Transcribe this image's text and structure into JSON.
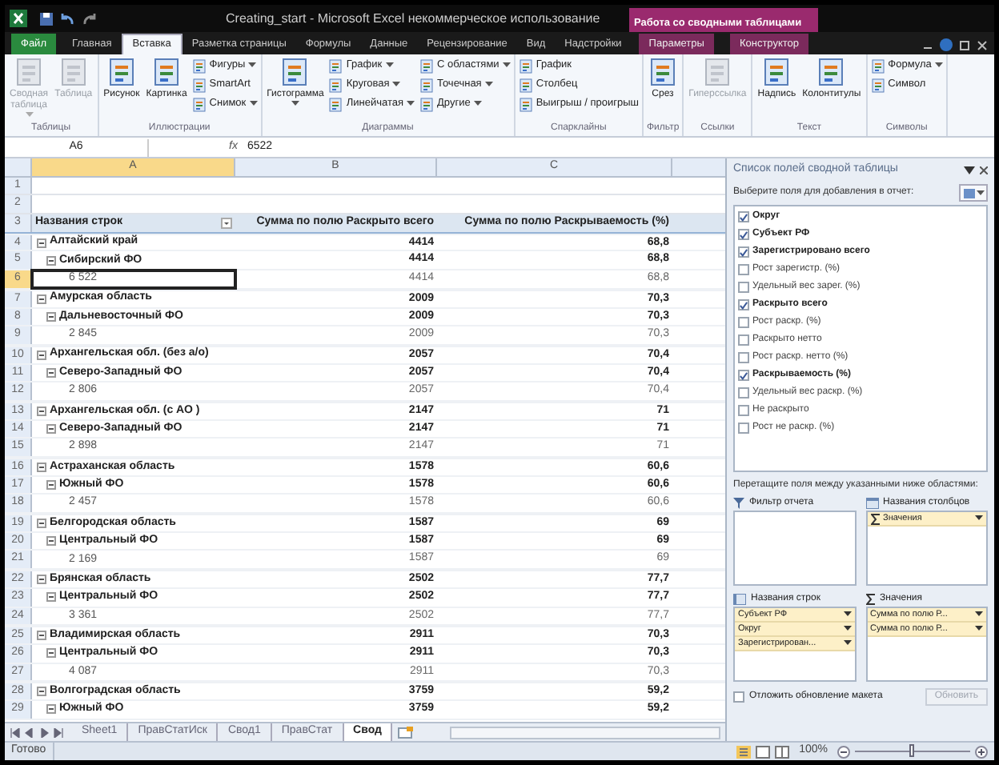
{
  "window": {
    "title": "Creating_start - Microsoft Excel некоммерческое использование",
    "contextual_group": "Работа со сводными таблицами"
  },
  "tabs": [
    {
      "label": "Файл",
      "kind": "file",
      "selected": false
    },
    {
      "label": "Главная",
      "kind": "normal",
      "selected": false
    },
    {
      "label": "Вставка",
      "kind": "normal",
      "selected": true
    },
    {
      "label": "Разметка страницы",
      "kind": "normal",
      "selected": false
    },
    {
      "label": "Формулы",
      "kind": "normal",
      "selected": false
    },
    {
      "label": "Данные",
      "kind": "normal",
      "selected": false
    },
    {
      "label": "Рецензирование",
      "kind": "normal",
      "selected": false
    },
    {
      "label": "Вид",
      "kind": "normal",
      "selected": false
    },
    {
      "label": "Надстройки",
      "kind": "normal",
      "selected": false
    },
    {
      "label": "Параметры",
      "kind": "contextual",
      "selected": false
    },
    {
      "label": "Конструктор",
      "kind": "contextual",
      "selected": false
    }
  ],
  "ribbon": [
    {
      "label": "Таблицы",
      "large": [
        {
          "label": "Сводная таблица",
          "disabled": true,
          "menu": true
        },
        {
          "label": "Таблица",
          "disabled": true,
          "menu": false
        }
      ]
    },
    {
      "label": "Иллюстрации",
      "large": [
        {
          "label": "Рисунок",
          "disabled": false,
          "menu": false
        },
        {
          "label": "Картинка",
          "disabled": false,
          "menu": false
        }
      ],
      "small": [
        {
          "label": "Фигуры",
          "menu": true
        },
        {
          "label": "SmartArt",
          "menu": false
        },
        {
          "label": "Снимок",
          "menu": true
        }
      ]
    },
    {
      "label": "Диаграммы",
      "large": [
        {
          "label": "Гистограмма",
          "disabled": false,
          "menu": true
        }
      ],
      "small": [
        {
          "label": "График",
          "menu": true
        },
        {
          "label": "Круговая",
          "menu": true
        },
        {
          "label": "Линейчатая",
          "menu": true
        },
        {
          "label": "С областями",
          "menu": true
        },
        {
          "label": "Точечная",
          "menu": true
        },
        {
          "label": "Другие",
          "menu": true
        }
      ]
    },
    {
      "label": "Спарклайны",
      "small": [
        {
          "label": "График",
          "menu": false
        },
        {
          "label": "Столбец",
          "menu": false
        },
        {
          "label": "Выигрыш / проигрыш",
          "menu": false
        }
      ]
    },
    {
      "label": "Фильтр",
      "large": [
        {
          "label": "Срез",
          "disabled": false,
          "menu": false
        }
      ]
    },
    {
      "label": "Ссылки",
      "large": [
        {
          "label": "Гиперссылка",
          "disabled": true,
          "menu": false
        }
      ]
    },
    {
      "label": "Текст",
      "large": [
        {
          "label": "Надпись",
          "disabled": false,
          "menu": false
        },
        {
          "label": "Колонтитулы",
          "disabled": false,
          "menu": false
        }
      ]
    },
    {
      "label": "Символы",
      "small": [
        {
          "label": "Формула",
          "menu": true
        },
        {
          "label": "Символ",
          "menu": false
        }
      ]
    }
  ],
  "formula_bar": {
    "name_box": "A6",
    "fx": "fx",
    "value": "6522"
  },
  "columns": [
    "A",
    "B",
    "C"
  ],
  "blank_rows": [
    "1",
    "2"
  ],
  "pivot_header": {
    "row": "3",
    "row_labels": "Названия строк",
    "col_b": "Сумма по полю Раскрыто всего",
    "col_c": "Сумма по полю Раскрываемость (%)"
  },
  "pivot_rows": [
    {
      "row": "4",
      "label": "Алтайский край",
      "b": "4414",
      "c": "68,8",
      "expanded": true,
      "selected": false,
      "children": [
        {
          "row": "5",
          "label": "Сибирский ФО",
          "b": "4414",
          "c": "68,8",
          "expanded": true,
          "selected": false,
          "children": [
            {
              "row": "6",
              "label": "6 522",
              "b": "4414",
              "c": "68,8",
              "selected": true
            }
          ]
        }
      ]
    },
    {
      "row": "7",
      "label": "Амурская область",
      "b": "2009",
      "c": "70,3",
      "expanded": true,
      "selected": false,
      "children": [
        {
          "row": "8",
          "label": "Дальневосточный ФО",
          "b": "2009",
          "c": "70,3",
          "expanded": true,
          "selected": false,
          "children": [
            {
              "row": "9",
              "label": "2 845",
              "b": "2009",
              "c": "70,3",
              "selected": false
            }
          ]
        }
      ]
    },
    {
      "row": "10",
      "label": "Архангельская обл. (без а/о)",
      "b": "2057",
      "c": "70,4",
      "expanded": true,
      "selected": false,
      "children": [
        {
          "row": "11",
          "label": "Северо-Западный ФО",
          "b": "2057",
          "c": "70,4",
          "expanded": true,
          "selected": false,
          "children": [
            {
              "row": "12",
              "label": "2 806",
              "b": "2057",
              "c": "70,4",
              "selected": false
            }
          ]
        }
      ]
    },
    {
      "row": "13",
      "label": "Архангельская обл. (с АО )",
      "b": "2147",
      "c": "71",
      "expanded": true,
      "selected": false,
      "children": [
        {
          "row": "14",
          "label": "Северо-Западный ФО",
          "b": "2147",
          "c": "71",
          "expanded": true,
          "selected": false,
          "children": [
            {
              "row": "15",
              "label": "2 898",
              "b": "2147",
              "c": "71",
              "selected": false
            }
          ]
        }
      ]
    },
    {
      "row": "16",
      "label": "Астраханская область",
      "b": "1578",
      "c": "60,6",
      "expanded": true,
      "selected": false,
      "children": [
        {
          "row": "17",
          "label": "Южный ФО",
          "b": "1578",
          "c": "60,6",
          "expanded": true,
          "selected": false,
          "children": [
            {
              "row": "18",
              "label": "2 457",
              "b": "1578",
              "c": "60,6",
              "selected": false
            }
          ]
        }
      ]
    },
    {
      "row": "19",
      "label": "Белгородская область",
      "b": "1587",
      "c": "69",
      "expanded": true,
      "selected": false,
      "children": [
        {
          "row": "20",
          "label": "Центральный ФО",
          "b": "1587",
          "c": "69",
          "expanded": true,
          "selected": false,
          "children": [
            {
              "row": "21",
              "label": "2 169",
              "b": "1587",
              "c": "69",
              "selected": false
            }
          ]
        }
      ]
    },
    {
      "row": "22",
      "label": "Брянская область",
      "b": "2502",
      "c": "77,7",
      "expanded": true,
      "selected": false,
      "children": [
        {
          "row": "23",
          "label": "Центральный ФО",
          "b": "2502",
          "c": "77,7",
          "expanded": true,
          "selected": false,
          "children": [
            {
              "row": "24",
              "label": "3 361",
              "b": "2502",
              "c": "77,7",
              "selected": false
            }
          ]
        }
      ]
    },
    {
      "row": "25",
      "label": "Владимирская область",
      "b": "2911",
      "c": "70,3",
      "expanded": true,
      "selected": false,
      "children": [
        {
          "row": "26",
          "label": "Центральный ФО",
          "b": "2911",
          "c": "70,3",
          "expanded": true,
          "selected": false,
          "children": [
            {
              "row": "27",
              "label": "4 087",
              "b": "2911",
              "c": "70,3",
              "selected": false
            }
          ]
        }
      ]
    },
    {
      "row": "28",
      "label": "Волгоградская область",
      "b": "3759",
      "c": "59,2",
      "expanded": true,
      "selected": false,
      "children": [
        {
          "row": "29",
          "label": "Южный ФО",
          "b": "3759",
          "c": "59,2",
          "expanded": true,
          "selected": false
        }
      ]
    }
  ],
  "sheet_tabs": [
    {
      "label": "Sheet1",
      "selected": false
    },
    {
      "label": "ПравСтатИск",
      "selected": false
    },
    {
      "label": "Свод1",
      "selected": false
    },
    {
      "label": "ПравСтат",
      "selected": false
    },
    {
      "label": "Свод",
      "selected": true
    }
  ],
  "field_list": {
    "title": "Список полей сводной таблицы",
    "prompt": "Выберите поля для добавления в отчет:",
    "fields": [
      {
        "label": "Округ",
        "checked": true
      },
      {
        "label": "Субъект РФ",
        "checked": true
      },
      {
        "label": "Зарегистрировано всего",
        "checked": true
      },
      {
        "label": "Рост зарегистр. (%)",
        "checked": false
      },
      {
        "label": "Удельный вес зарег. (%)",
        "checked": false
      },
      {
        "label": "Раскрыто всего",
        "checked": true
      },
      {
        "label": "Рост раскр. (%)",
        "checked": false
      },
      {
        "label": "Раскрыто нетто",
        "checked": false
      },
      {
        "label": "Рост раскр. нетто (%)",
        "checked": false
      },
      {
        "label": "Раскрываемость (%)",
        "checked": true
      },
      {
        "label": "Удельный вес раскр. (%)",
        "checked": false
      },
      {
        "label": "Не раскрыто",
        "checked": false
      },
      {
        "label": "Рост не раскр. (%)",
        "checked": false
      }
    ],
    "drag_prompt": "Перетащите поля между указанными ниже областями:",
    "areas": [
      {
        "kind": "filter",
        "label": "Фильтр отчета"
      },
      {
        "kind": "columns",
        "label": "Названия столбцов",
        "items": [
          "Значения"
        ]
      },
      {
        "kind": "rows",
        "label": "Названия строк",
        "items": [
          "Субъект РФ",
          "Округ",
          "Зарегистрирован..."
        ]
      },
      {
        "kind": "values",
        "label": "Значения",
        "items": [
          "Сумма по полю Р...",
          "Сумма по полю Р..."
        ]
      }
    ],
    "defer": {
      "label": "Отложить обновление макета",
      "checked": false
    },
    "update_button": {
      "label": "Обновить",
      "disabled": true
    }
  },
  "status_bar": {
    "text": "Готово",
    "zoom": "100%",
    "zoom_slider": {
      "level": 0.5
    }
  }
}
